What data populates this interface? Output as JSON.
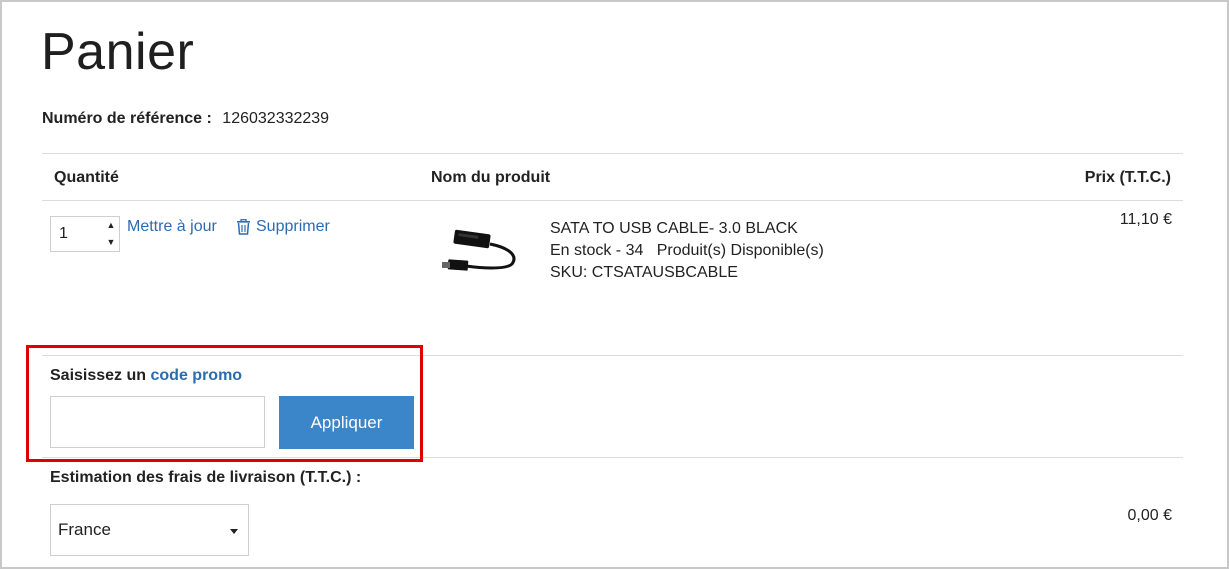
{
  "page": {
    "title": "Panier"
  },
  "reference": {
    "label": "Numéro de référence :",
    "value": "126032332239"
  },
  "table": {
    "headers": {
      "quantity": "Quantité",
      "product": "Nom du produit",
      "price": "Prix (T.T.C.)"
    }
  },
  "item": {
    "quantity": "1",
    "update_label": "Mettre à jour",
    "delete_label": "Supprimer",
    "name": "SATA TO USB CABLE- 3.0 BLACK",
    "stock": "En stock - 34   Produit(s) Disponible(s)",
    "sku": "SKU: CTSATAUSBCABLE",
    "price": "11,10 €",
    "image_icon": "usb-cable-image"
  },
  "promo": {
    "label_prefix": "Saisissez un",
    "label_accent": "code promo",
    "input_value": "",
    "apply_label": "Appliquer"
  },
  "shipping": {
    "label": "Estimation des frais de livraison (T.T.C.) :",
    "country": "France",
    "price": "0,00 €"
  },
  "colors": {
    "accent": "#2b6cb0",
    "button": "#3a86c8",
    "highlight": "#e00000"
  }
}
